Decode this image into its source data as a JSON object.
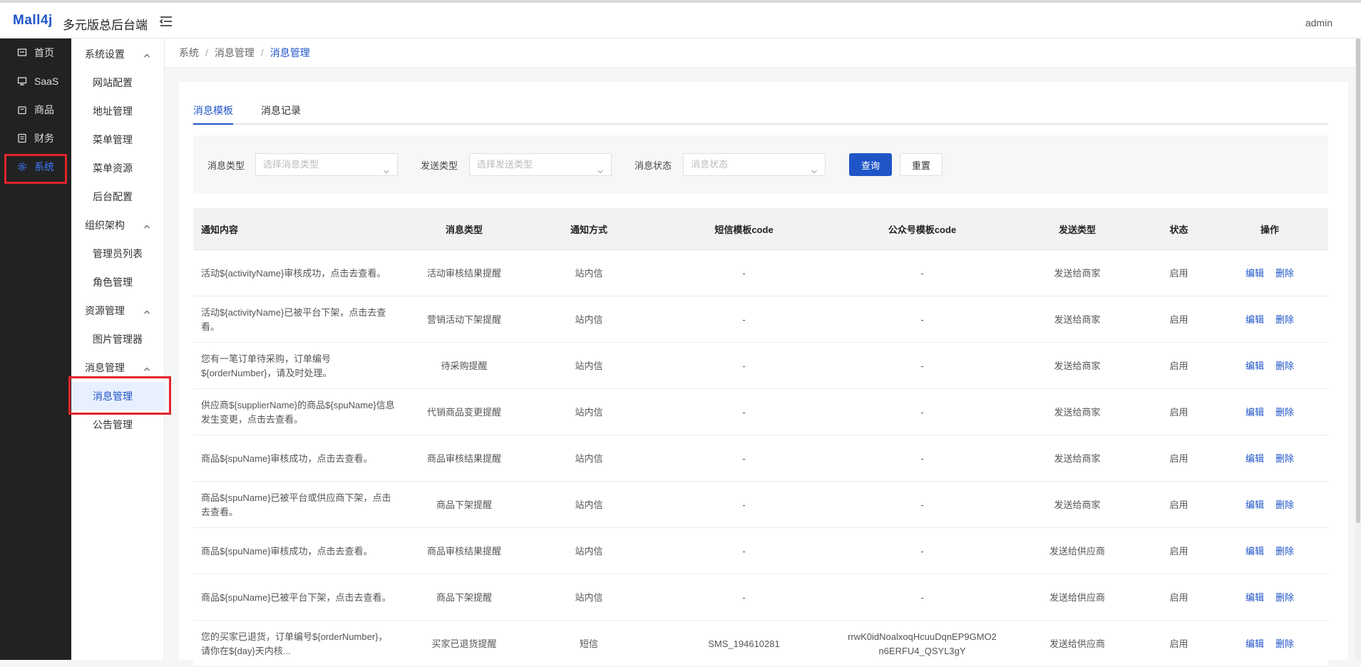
{
  "header": {
    "logo": "Mall4j",
    "title": "多元版总后台端",
    "user": "admin"
  },
  "rail": [
    {
      "label": "首页",
      "icon": "home-icon"
    },
    {
      "label": "SaaS",
      "icon": "monitor-icon"
    },
    {
      "label": "商品",
      "icon": "bag-icon"
    },
    {
      "label": "财务",
      "icon": "wallet-icon"
    },
    {
      "label": "系统",
      "icon": "gear-icon",
      "active": true
    }
  ],
  "submenu": {
    "groups": [
      {
        "label": "系统设置",
        "items": [
          "网站配置",
          "地址管理",
          "菜单管理",
          "菜单资源",
          "后台配置"
        ]
      },
      {
        "label": "组织架构",
        "items": [
          "管理员列表",
          "角色管理"
        ]
      },
      {
        "label": "资源管理",
        "items": [
          "图片管理器"
        ]
      },
      {
        "label": "消息管理",
        "items": [
          "消息管理",
          "公告管理"
        ]
      }
    ]
  },
  "breadcrumb": {
    "items": [
      "系统",
      "消息管理"
    ],
    "current": "消息管理",
    "separator": "/"
  },
  "tabs": [
    {
      "label": "消息模板",
      "active": true
    },
    {
      "label": "消息记录"
    }
  ],
  "filters": {
    "msg_type": {
      "label": "消息类型",
      "placeholder": "选择消息类型"
    },
    "send_type": {
      "label": "发送类型",
      "placeholder": "选择发送类型"
    },
    "status": {
      "label": "消息状态",
      "placeholder": "消息状态"
    },
    "query_label": "查询",
    "reset_label": "重置"
  },
  "table": {
    "columns": [
      "通知内容",
      "消息类型",
      "通知方式",
      "短信模板code",
      "公众号模板code",
      "发送类型",
      "状态",
      "操作"
    ],
    "edit_label": "编辑",
    "delete_label": "删除",
    "rows": [
      {
        "content": "活动${activityName}审核成功，点击去查看。",
        "type": "活动审核结果提醒",
        "method": "站内信",
        "sms": "-",
        "wechat": "-",
        "send": "发送给商家",
        "status": "启用"
      },
      {
        "content": "活动${activityName}已被平台下架，点击去查看。",
        "type": "营销活动下架提醒",
        "method": "站内信",
        "sms": "-",
        "wechat": "-",
        "send": "发送给商家",
        "status": "启用"
      },
      {
        "content": "您有一笔订单待采购，订单编号${orderNumber}，请及时处理。",
        "type": "待采购提醒",
        "method": "站内信",
        "sms": "-",
        "wechat": "-",
        "send": "发送给商家",
        "status": "启用"
      },
      {
        "content": "供应商${supplierName}的商品${spuName}信息发生变更，点击去查看。",
        "type": "代销商品变更提醒",
        "method": "站内信",
        "sms": "-",
        "wechat": "-",
        "send": "发送给商家",
        "status": "启用"
      },
      {
        "content": "商品${spuName}审核成功，点击去查看。",
        "type": "商品审核结果提醒",
        "method": "站内信",
        "sms": "-",
        "wechat": "-",
        "send": "发送给商家",
        "status": "启用"
      },
      {
        "content": "商品${spuName}已被平台或供应商下架，点击去查看。",
        "type": "商品下架提醒",
        "method": "站内信",
        "sms": "-",
        "wechat": "-",
        "send": "发送给商家",
        "status": "启用"
      },
      {
        "content": "商品${spuName}审核成功，点击去查看。",
        "type": "商品审核结果提醒",
        "method": "站内信",
        "sms": "-",
        "wechat": "-",
        "send": "发送给供应商",
        "status": "启用"
      },
      {
        "content": "商品${spuName}已被平台下架，点击去查看。",
        "type": "商品下架提醒",
        "method": "站内信",
        "sms": "-",
        "wechat": "-",
        "send": "发送给供应商",
        "status": "启用"
      },
      {
        "content": "您的买家已退货，订单编号${orderNumber}，请你在${day}天内核...",
        "type": "买家已退货提醒",
        "method": "短信",
        "sms": "SMS_194610281",
        "wechat": "rrwK0idNoalxoqHcuuDqnEP9GMO2n6ERFU4_QSYL3gY",
        "send": "发送给供应商",
        "status": "启用"
      }
    ]
  },
  "colors": {
    "accent": "#1f55c7",
    "rail_bg": "#222222",
    "highlight": "#e3242b"
  }
}
